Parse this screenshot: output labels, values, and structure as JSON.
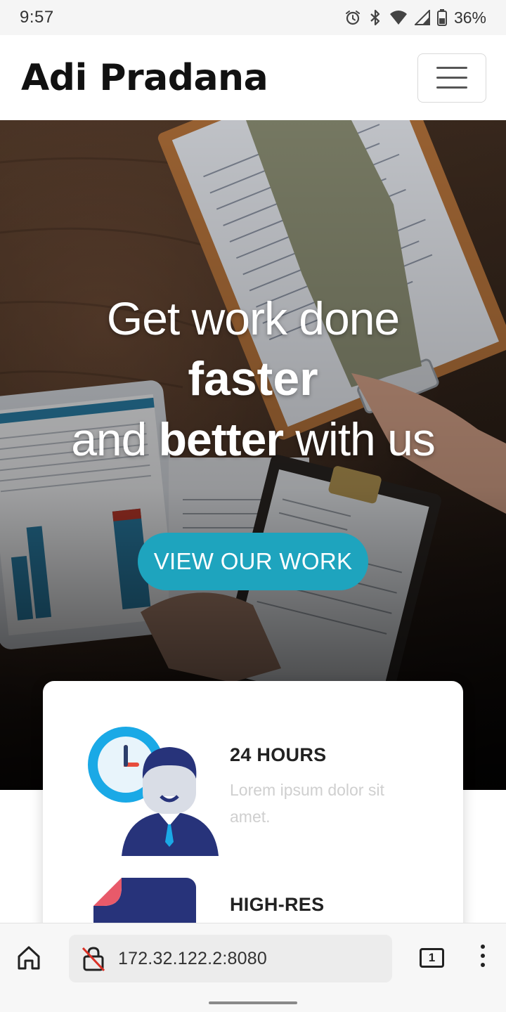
{
  "status_bar": {
    "time": "9:57",
    "battery": "36%",
    "icons": [
      "alarm-icon",
      "bluetooth-icon",
      "wifi-icon",
      "signal-icon",
      "battery-icon"
    ]
  },
  "navbar": {
    "brand": "Adi Pradana",
    "menu_icon": "hamburger-menu-icon"
  },
  "hero": {
    "line1": "Get work done",
    "line2": "faster",
    "line3_pre": "and ",
    "line3_bold": "better",
    "line3_post": " with us",
    "cta_label": "VIEW OUR WORK",
    "accent_color": "#1ea4be"
  },
  "features": [
    {
      "title": "24 HOURS",
      "description": "Lorem ipsum dolor sit amet.",
      "icon": "clock-person-icon"
    },
    {
      "title": "HIGH-RES",
      "description": "",
      "icon": "document-icon"
    }
  ],
  "browser": {
    "url": "172.32.122.2:8080",
    "tab_count": "1",
    "icons": [
      "home-icon",
      "insecure-lock-icon",
      "tabs-icon",
      "overflow-menu-icon"
    ]
  }
}
